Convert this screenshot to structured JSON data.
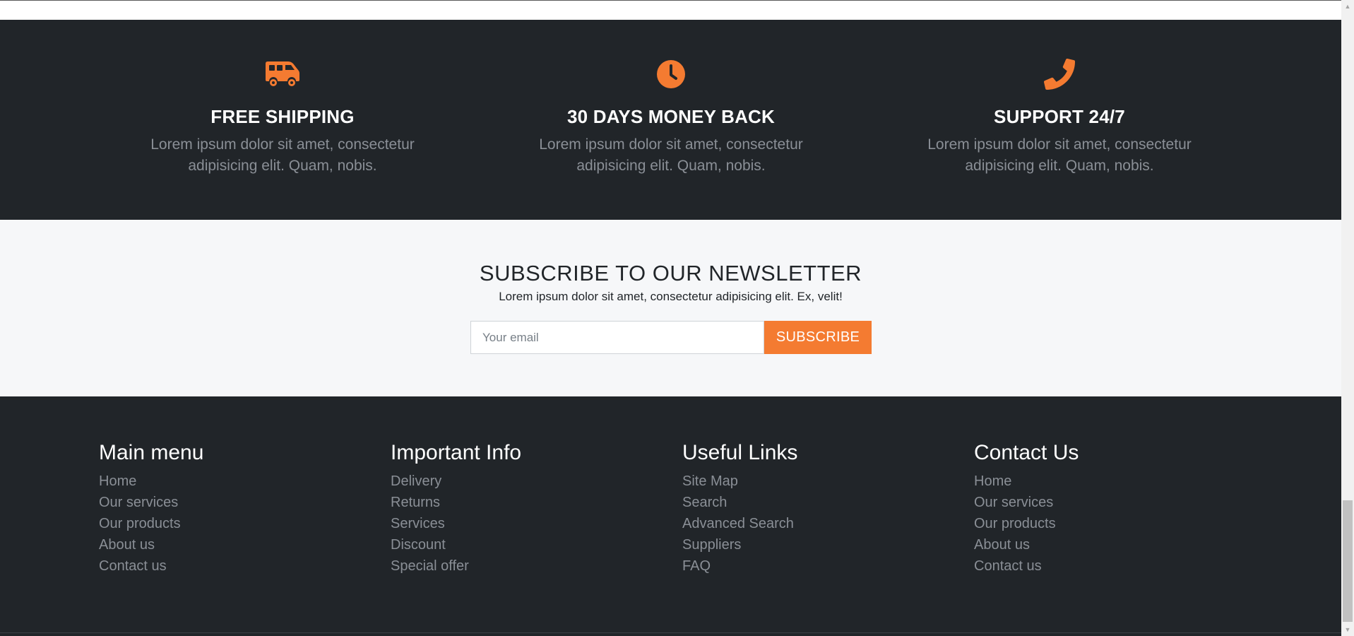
{
  "features": [
    {
      "icon": "truck-icon",
      "title": "FREE SHIPPING",
      "text": "Lorem ipsum dolor sit amet, consectetur adipisicing elit. Quam, nobis."
    },
    {
      "icon": "clock-icon",
      "title": "30 DAYS MONEY BACK",
      "text": "Lorem ipsum dolor sit amet, consectetur adipisicing elit. Quam, nobis."
    },
    {
      "icon": "phone-icon",
      "title": "SUPPORT 24/7",
      "text": "Lorem ipsum dolor sit amet, consectetur adipisicing elit. Quam, nobis."
    }
  ],
  "newsletter": {
    "title": "SUBSCRIBE TO OUR NEWSLETTER",
    "subtitle": "Lorem ipsum dolor sit amet, consectetur adipisicing elit. Ex, velit!",
    "email_placeholder": "Your email",
    "button_label": "SUBSCRIBE"
  },
  "footer": {
    "columns": [
      {
        "title": "Main menu",
        "links": [
          "Home",
          "Our services",
          "Our products",
          "About us",
          "Contact us"
        ]
      },
      {
        "title": "Important Info",
        "links": [
          "Delivery",
          "Returns",
          "Services",
          "Discount",
          "Special offer"
        ]
      },
      {
        "title": "Useful Links",
        "links": [
          "Site Map",
          "Search",
          "Advanced Search",
          "Suppliers",
          "FAQ"
        ]
      },
      {
        "title": "Contact Us",
        "links": [
          "Home",
          "Our services",
          "Our products",
          "About us",
          "Contact us"
        ]
      }
    ]
  },
  "colors": {
    "accent": "#f47b31",
    "dark_background": "#212529",
    "light_background": "#f6f7f9",
    "muted_text": "#8a8f96"
  }
}
